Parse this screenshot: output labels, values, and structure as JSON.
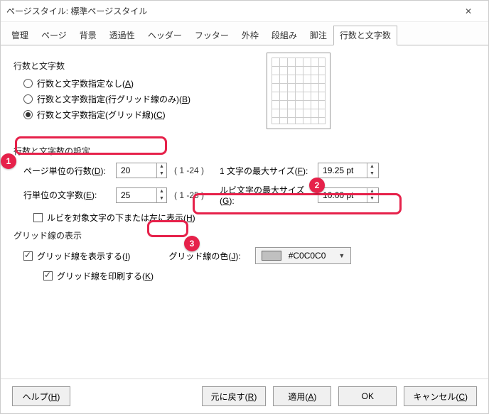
{
  "window": {
    "title": "ページスタイル: 標準ページスタイル"
  },
  "tabs": [
    "管理",
    "ページ",
    "背景",
    "透過性",
    "ヘッダー",
    "フッター",
    "外枠",
    "段組み",
    "脚注",
    "行数と文字数"
  ],
  "active_tab_index": 9,
  "grid_section_title": "行数と文字数",
  "radios": {
    "r1": "行数と文字数指定なし(A)",
    "r2": "行数と文字数指定(行グリッド線のみ)(B)",
    "r3": "行数と文字数指定(グリッド線)(C)"
  },
  "settings_title": "行数と文字数の設定",
  "lines_per_page_label": "ページ単位の行数(D):",
  "lines_per_page_value": "20",
  "lines_per_page_range": "( 1 -24 )",
  "chars_per_line_label": "行単位の文字数(E):",
  "chars_per_line_value": "25",
  "chars_per_line_range": "( 1 -25 )",
  "char_max_label": "1 文字の最大サイズ(F):",
  "char_max_value": "19.25 pt",
  "ruby_max_label": "ルビ文字の最大サイズ(G):",
  "ruby_max_value": "10.00 pt",
  "ruby_checkbox_label": "ルビを対象文字の下または左に表示(H)",
  "grid_display_title": "グリッド線の表示",
  "show_grid_label": "グリッド線を表示する(I)",
  "grid_color_label": "グリッド線の色(J):",
  "grid_color_value": "#C0C0C0",
  "print_grid_label": "グリッド線を印刷する(K)",
  "buttons": {
    "help": "ヘルプ(H)",
    "reset": "元に戻す(R)",
    "apply": "適用(A)",
    "ok": "OK",
    "cancel": "キャンセル(C)"
  },
  "markers": {
    "m1": "1",
    "m2": "2",
    "m3": "3"
  }
}
